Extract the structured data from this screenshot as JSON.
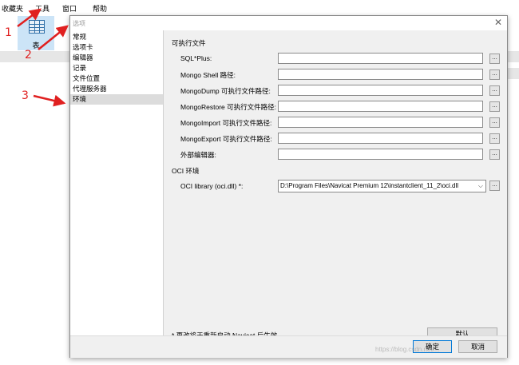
{
  "menubar": {
    "items": [
      "收藏夹",
      "工具",
      "窗口",
      "帮助"
    ]
  },
  "toolbar": {
    "table_label": "表"
  },
  "dialog": {
    "title": "选项",
    "close": "✕",
    "nav": [
      "常规",
      "选项卡",
      "编辑器",
      "记录",
      "文件位置",
      "代理服务器",
      "环境"
    ],
    "selected_nav": "环境",
    "exec_section": "可执行文件",
    "exec_rows": [
      {
        "label": "SQL*Plus:",
        "value": ""
      },
      {
        "label": "Mongo Shell 路径:",
        "value": ""
      },
      {
        "label": "MongoDump 可执行文件路径:",
        "value": ""
      },
      {
        "label": "MongoRestore 可执行文件路径:",
        "value": ""
      },
      {
        "label": "MongoImport 可执行文件路径:",
        "value": ""
      },
      {
        "label": "MongoExport 可执行文件路径:",
        "value": ""
      },
      {
        "label": "外部编辑器:",
        "value": ""
      }
    ],
    "browse_label": "...",
    "oci_section": "OCI 环境",
    "oci_label": "OCI library (oci.dll) *:",
    "oci_value": "D:\\Program Files\\Navicat Premium 12\\instantclient_11_2\\oci.dll",
    "note": "* 更改将于重新启动 Navicat 后生效",
    "default_button": "默认",
    "ok_button": "确定",
    "cancel_button": "取消"
  },
  "annotations": {
    "n1": "1",
    "n2": "2",
    "n3": "3",
    "color": "#e02020"
  },
  "watermark": "https://blog.csdn.net/..."
}
